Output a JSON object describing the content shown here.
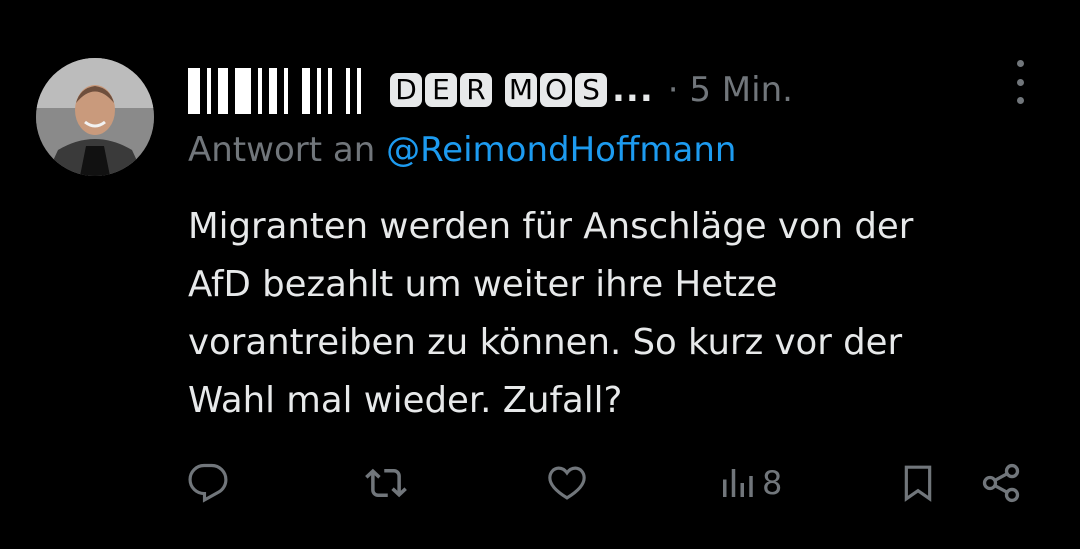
{
  "tweet": {
    "author_display_letters": [
      "D",
      "E",
      "R",
      " ",
      "M",
      "O",
      "S"
    ],
    "author_ellipsis": "...",
    "timestamp": "· 5 Min.",
    "reply_prefix": "Antwort an",
    "reply_handle": "@ReimondHoffmann",
    "text_lines": [
      "Migranten werden für Anschläge von der",
      "AfD bezahlt um weiter ihre Hetze",
      "vorantreiben zu können. So kurz vor der",
      "Wahl mal wieder. Zufall?"
    ],
    "views_count": "8"
  },
  "icons": {
    "more": "more-vertical-icon",
    "reply": "reply-icon",
    "retweet": "retweet-icon",
    "like": "heart-icon",
    "views": "views-chart-icon",
    "bookmark": "bookmark-icon",
    "share": "share-icon"
  },
  "colors": {
    "background": "#000000",
    "text": "#e7e9ea",
    "muted": "#71767b",
    "link": "#1d9bf0"
  }
}
